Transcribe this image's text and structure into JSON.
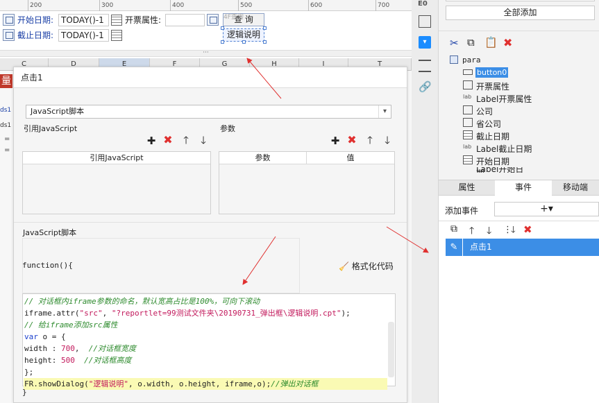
{
  "ruler": {
    "ticks": [
      "200",
      "300",
      "400",
      "500",
      "600",
      "700"
    ]
  },
  "params": {
    "start_date_label": "开始日期:",
    "start_date_value": "TODAY()-1",
    "end_date_label": "截止日期:",
    "end_date_value": "TODAY()-1",
    "invoice_label": "开票属性:",
    "query_button": "查 询",
    "query_button_overlay": "4F查询",
    "logic_button": "逻辑说明"
  },
  "splitbar": {
    "handle": "···"
  },
  "grid": {
    "columns": [
      "C",
      "D",
      "E",
      "F",
      "G",
      "H",
      "I",
      "T"
    ],
    "side_labels": [
      "量",
      "ds1",
      "ds1",
      "=",
      "="
    ]
  },
  "dialog": {
    "title": "点击1",
    "script_type": "JavaScript脚本",
    "ref_section": "引用JavaScript",
    "param_section": "参数",
    "ref_column": "引用JavaScript",
    "param_column": "参数",
    "value_column": "值",
    "script_section": "JavaScript脚本",
    "function_header": "function(){",
    "format_button": "格式化代码",
    "code_lines": [
      "// 对话框内iframe参数的命名，默认宽高占比是100%，可向下滚动",
      "iframe.attr(\"src\", \"?reportlet=99测试文件夹\\20190731_弹出框\\逻辑说明.cpt\");",
      "// 给iframe添加src属性",
      "var o = {",
      "width : 700,  //对话框宽度",
      "height: 500  //对话框高度",
      "};",
      "FR.showDialog(\"逻辑说明\", o.width, o.height, iframe,o);//弹出对话框"
    ],
    "closing_brace": "}"
  },
  "right_panel": {
    "add_all_button": "全部添加",
    "tree_root": "para",
    "tree_items": [
      "button0",
      "开票属性",
      "Label开票属性",
      "公司",
      "省公司",
      "截止日期",
      "Label截止日期",
      "开始日期",
      "Label开始日期"
    ],
    "tabs": [
      "属性",
      "事件",
      "移动端"
    ],
    "add_event_label": "添加事件",
    "add_event_symbol": "+▾",
    "event_item": "点击1",
    "sidebar_top_label": "E0"
  },
  "colors": {
    "accent": "#1a8cff",
    "selected": "#3c8ee6",
    "red": "#e0302f",
    "code_highlight": "#fafab4"
  }
}
